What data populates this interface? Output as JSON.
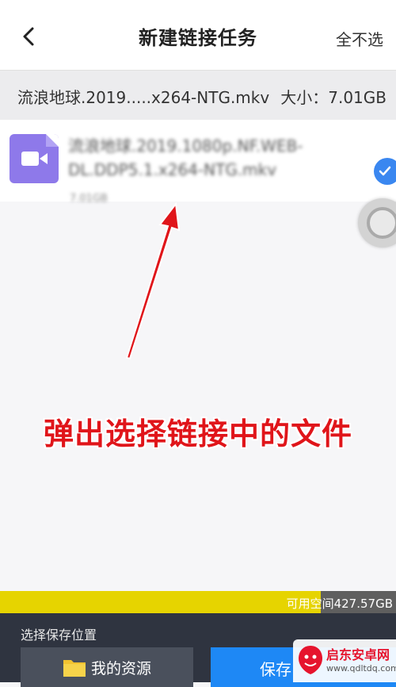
{
  "header": {
    "title": "新建链接任务",
    "deselect_all": "全不选"
  },
  "info": {
    "filename": "流浪地球.2019.....x264-NTG.mkv",
    "size": "大小：7.01GB"
  },
  "file": {
    "name": "流浪地球.2019.1080p.NF.WEB-DL.DDP5.1.x264-NTG.mkv",
    "size": "7.01GB",
    "selected": true
  },
  "annotation": {
    "text": "弹出选择链接中的文件",
    "color": "#e0151a"
  },
  "storage": {
    "available": "可用空间427.57GB",
    "used_fraction": 0.81
  },
  "bottom": {
    "location_label": "选择保存位置",
    "my_resources": "我的资源",
    "save": "保存"
  },
  "watermark": {
    "name": "启东安卓网",
    "url": "www.qdltdq.com"
  },
  "colors": {
    "accent": "#1e88f5",
    "video_icon": "#8e79ea",
    "storage_fill": "#e6d400"
  }
}
